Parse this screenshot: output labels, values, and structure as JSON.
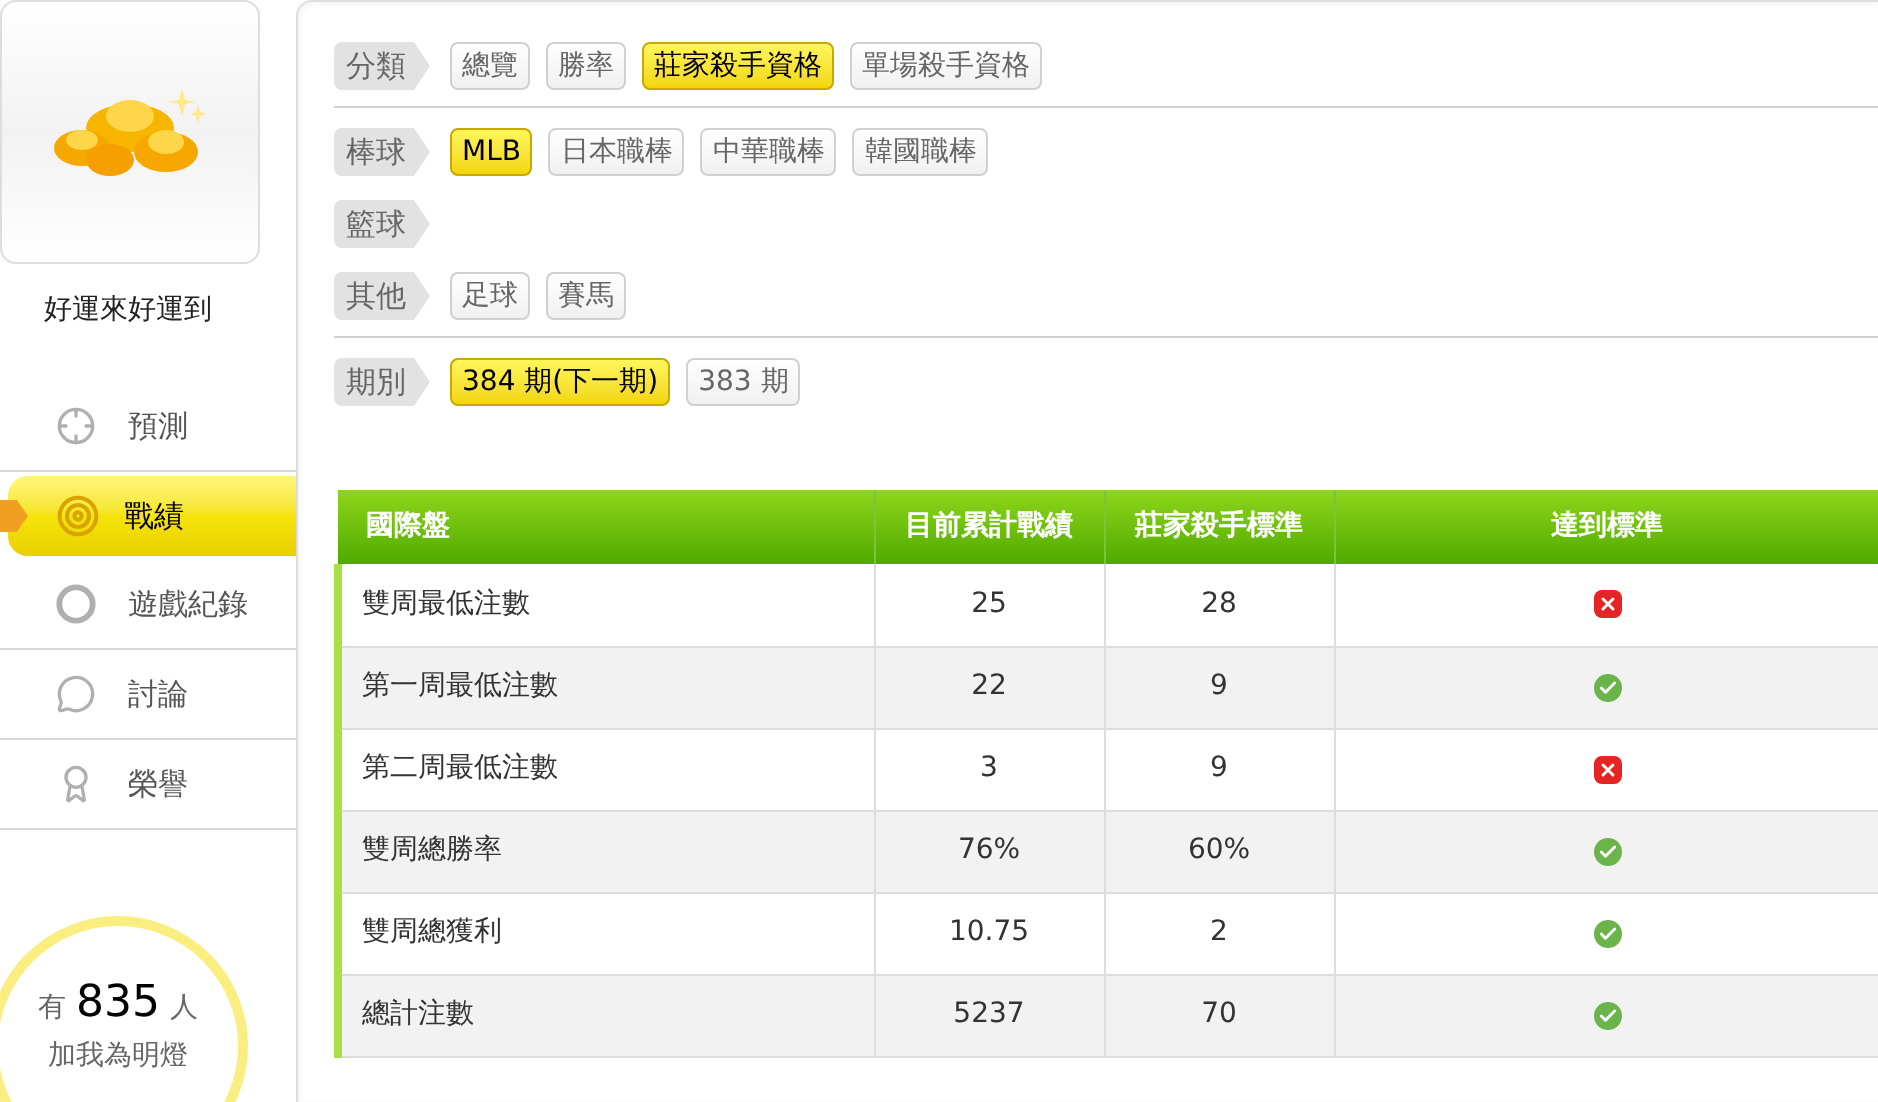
{
  "sidebar": {
    "profile_name": "好運來好運到",
    "nav": [
      {
        "label": "預測",
        "selected": false
      },
      {
        "label": "戰績",
        "selected": true
      },
      {
        "label": "遊戲紀錄",
        "selected": false
      },
      {
        "label": "討論",
        "selected": false
      },
      {
        "label": "榮譽",
        "selected": false
      }
    ],
    "fans": {
      "prefix": "有",
      "count": "835",
      "suffix": "人",
      "caption": "加我為明燈"
    }
  },
  "filters": [
    {
      "group": [
        {
          "label": "分類",
          "options": [
            {
              "text": "總覽",
              "selected": false
            },
            {
              "text": "勝率",
              "selected": false
            },
            {
              "text": "莊家殺手資格",
              "selected": true
            },
            {
              "text": "單場殺手資格",
              "selected": false
            }
          ]
        }
      ]
    },
    {
      "group": [
        {
          "label": "棒球",
          "options": [
            {
              "text": "MLB",
              "selected": true
            },
            {
              "text": "日本職棒",
              "selected": false
            },
            {
              "text": "中華職棒",
              "selected": false
            },
            {
              "text": "韓國職棒",
              "selected": false
            }
          ]
        },
        {
          "label": "籃球"
        },
        {
          "label": "其他",
          "options": [
            {
              "text": "足球",
              "selected": false
            },
            {
              "text": "賽馬",
              "selected": false
            }
          ]
        }
      ]
    },
    {
      "group": [
        {
          "label": "期別",
          "options": [
            {
              "text": "384 期(下一期)",
              "selected": true
            },
            {
              "text": "383 期",
              "selected": false
            }
          ]
        }
      ]
    }
  ],
  "table": {
    "columns": [
      "國際盤",
      "目前累計戰績",
      "莊家殺手標準",
      "達到標準"
    ],
    "rows": [
      {
        "item": "雙周最低注數",
        "current": "25",
        "standard": "28",
        "met": false
      },
      {
        "item": "第一周最低注數",
        "current": "22",
        "standard": "9",
        "met": true
      },
      {
        "item": "第二周最低注數",
        "current": "3",
        "standard": "9",
        "met": false
      },
      {
        "item": "雙周總勝率",
        "current": "76%",
        "standard": "60%",
        "met": true
      },
      {
        "item": "雙周總獲利",
        "current": "10.75",
        "standard": "2",
        "met": true
      },
      {
        "item": "總計注數",
        "current": "5237",
        "standard": "70",
        "met": true
      }
    ]
  }
}
